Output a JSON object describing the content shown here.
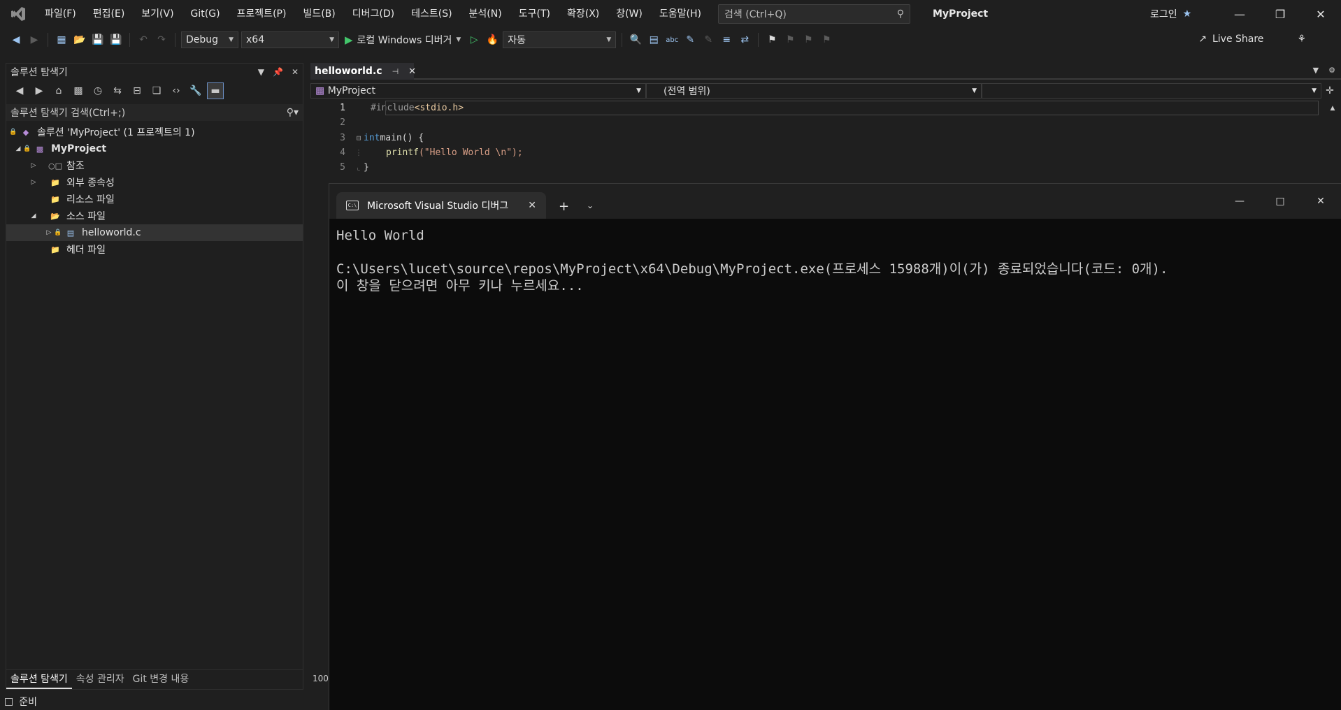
{
  "menu": {
    "items": [
      "파일(F)",
      "편집(E)",
      "보기(V)",
      "Git(G)",
      "프로젝트(P)",
      "빌드(B)",
      "디버그(D)",
      "테스트(S)",
      "분석(N)",
      "도구(T)",
      "확장(X)",
      "창(W)",
      "도움말(H)"
    ],
    "search_placeholder": "검색 (Ctrl+Q)",
    "app_title": "MyProject",
    "login": "로그인"
  },
  "toolbar": {
    "config": "Debug",
    "platform": "x64",
    "run_label": "로컬 Windows 디버거",
    "target": "자동",
    "live_share": "Live Share"
  },
  "solution_explorer": {
    "title": "솔루션 탐색기",
    "search_placeholder": "솔루션 탐색기 검색(Ctrl+;)",
    "tree": {
      "solution": "솔루션 'MyProject' (1 프로젝트의 1)",
      "project": "MyProject",
      "references": "참조",
      "external_deps": "외부 종속성",
      "resource_files": "리소스 파일",
      "source_files": "소스 파일",
      "source_file_1": "helloworld.c",
      "header_files": "헤더 파일"
    },
    "bottom_tabs": [
      "솔루션 탐색기",
      "속성 관리자",
      "Git 변경 내용"
    ]
  },
  "status": {
    "text": "준비"
  },
  "editor": {
    "tab_name": "helloworld.c",
    "nav_project": "MyProject",
    "nav_scope": "(전역 범위)",
    "zoom": "100",
    "lines": [
      {
        "num": "1",
        "pre": "#include ",
        "inc": "<stdio.h>"
      },
      {
        "num": "2"
      },
      {
        "num": "3",
        "kw": "int",
        "rest": " main() {"
      },
      {
        "num": "4",
        "fn": "printf",
        "str": "(\"Hello World \\n\");"
      },
      {
        "num": "5",
        "rest": "}"
      }
    ]
  },
  "terminal": {
    "tab_title": "Microsoft Visual Studio 디버그",
    "line1": "Hello World",
    "line2": "",
    "line3": "C:\\Users\\lucet\\source\\repos\\MyProject\\x64\\Debug\\MyProject.exe(프로세스 15988개)이(가) 종료되었습니다(코드: 0개).",
    "line4": "이 창을 닫으려면 아무 키나 누르세요..."
  },
  "colors": {
    "accent": "#9cc4f0",
    "run_green": "#43c66b",
    "folder": "#dcb67a",
    "project_purple": "#b68bd8"
  }
}
